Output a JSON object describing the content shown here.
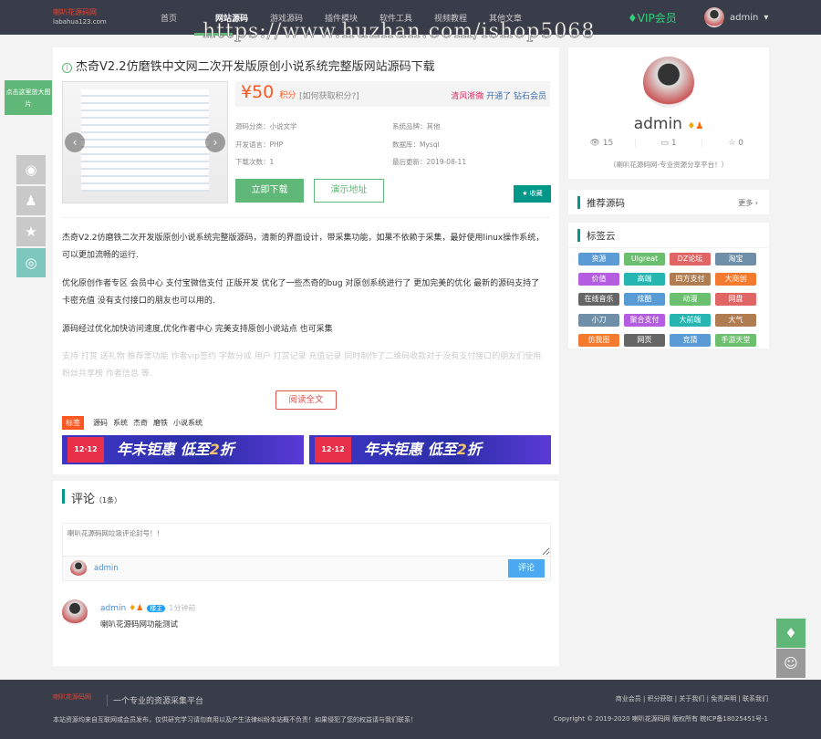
{
  "header": {
    "logo_text": "喇叭花源码网",
    "logo_sub": "labahua123.com",
    "nav": [
      "首页",
      "网站源码",
      "游戏源码",
      "插件模块",
      "软件工具",
      "视频教程",
      "其他文章"
    ],
    "vip": "VIP会员",
    "user": "admin"
  },
  "watermark": "https://www.huzhan.com/ishop5068",
  "article": {
    "title": "杰奇V2.2仿磨铁中文网二次开发版原创小说系统完整版网站源码下载",
    "price": "¥50",
    "price_unit": "积分",
    "how": "[如何获取积分?]",
    "notice_user": "清风淅微",
    "notice_text": "开通了 钻石会员",
    "meta": [
      {
        "k": "源码分类：",
        "v": "小说文学"
      },
      {
        "k": "系统品牌：",
        "v": "其他"
      },
      {
        "k": "开发语言：",
        "v": "PHP"
      },
      {
        "k": "数据库：",
        "v": "Mysql"
      },
      {
        "k": "下载次数：",
        "v": "1"
      },
      {
        "k": "最后更新：",
        "v": "2019-08-11"
      }
    ],
    "download": "立即下载",
    "demo": "演示地址",
    "fav": "收藏",
    "paras": [
      "杰奇V2.2仿磨铁二次开发版原创小说系统完整版源码，清新的界面设计，带采集功能，如果不依赖于采集，最好使用linux操作系统，可以更加流畅的运行.",
      "优化原创作者专区 会员中心 支付宝微信支付 正版开发 优化了一些杰奇的bug 对原创系统进行了 更加完美的优化 最新的源码支持了 卡密充值 没有支付接口的朋友也可以用的.",
      "源码经过优化加快访问速度,优化作者中心 完美支持原创小说站点 也可采集",
      "支持 打赏 送礼物 推荐票功能 作者vip签约 字数分成 用户 打赏记录 充值记录 同时制作了二维码收款对于没有支付接口的朋友们使用 粉丝共享榜 作者信息 等."
    ],
    "read_more": "阅读全文",
    "tag_label": "标签",
    "tags": [
      "源码",
      "系统",
      "杰奇",
      "磨铁",
      "小说系统"
    ],
    "ad": {
      "badge": "12·12",
      "text": "年末钜惠 低至",
      "num": "2",
      "suffix": "折"
    }
  },
  "profile": {
    "name": "admin",
    "views": "15",
    "comments": "1",
    "likes": "0",
    "motto": "（喇叭花源码网-专业资源分享平台！）"
  },
  "recommend": {
    "title": "推荐源码",
    "more": "更多"
  },
  "tagcloud": {
    "title": "标签云",
    "tags": [
      {
        "t": "资源",
        "c": "#5b9bd5"
      },
      {
        "t": "Ulgreat",
        "c": "#6cbf6e"
      },
      {
        "t": "DZ论坛",
        "c": "#e06666"
      },
      {
        "t": "淘宝",
        "c": "#6f8fa8"
      },
      {
        "t": "价值",
        "c": "#b45de0"
      },
      {
        "t": "高端",
        "c": "#26b5b0"
      },
      {
        "t": "四方支付",
        "c": "#b07d52"
      },
      {
        "t": "大商创",
        "c": "#f47a30"
      },
      {
        "t": "在线音乐",
        "c": "#666666"
      },
      {
        "t": "炫酷",
        "c": "#5b9bd5"
      },
      {
        "t": "动漫",
        "c": "#6cbf6e"
      },
      {
        "t": "网盘",
        "c": "#e06666"
      },
      {
        "t": "小刀",
        "c": "#6f8fa8"
      },
      {
        "t": "聚合支付",
        "c": "#b45de0"
      },
      {
        "t": "大前端",
        "c": "#26b5b0"
      },
      {
        "t": "大气",
        "c": "#b07d52"
      },
      {
        "t": "仿我图",
        "c": "#f47a30"
      },
      {
        "t": "网页",
        "c": "#666666"
      },
      {
        "t": "竞猜",
        "c": "#5b9bd5"
      },
      {
        "t": "手游天堂",
        "c": "#6cbf6e"
      }
    ]
  },
  "comments": {
    "title": "评论",
    "count": "（1条）",
    "placeholder": "喇叭花源码网垃圾评论封号！！",
    "user": "admin",
    "submit": "评论",
    "items": [
      {
        "user": "admin",
        "badge": "楼主",
        "time": "1分钟前",
        "text": "喇叭花源码网功能测试"
      }
    ]
  },
  "float": {
    "zoom_tip": "点击这里放大图片"
  },
  "footer": {
    "slogan": "一个专业的资源采集平台",
    "disclaimer": "本站资源均来自互联网或会员发布，仅供研究学习请勿商用以及产生法律纠纷本站概不负责！如果侵犯了您的权益请与我们联系！",
    "links": "商业会员 | 积分获取 | 关于我们 | 免责声明 | 联系我们",
    "copyright": "Copyright © 2019-2020 喇叭花源码网 版权所有 皖ICP备18025451号-1"
  }
}
